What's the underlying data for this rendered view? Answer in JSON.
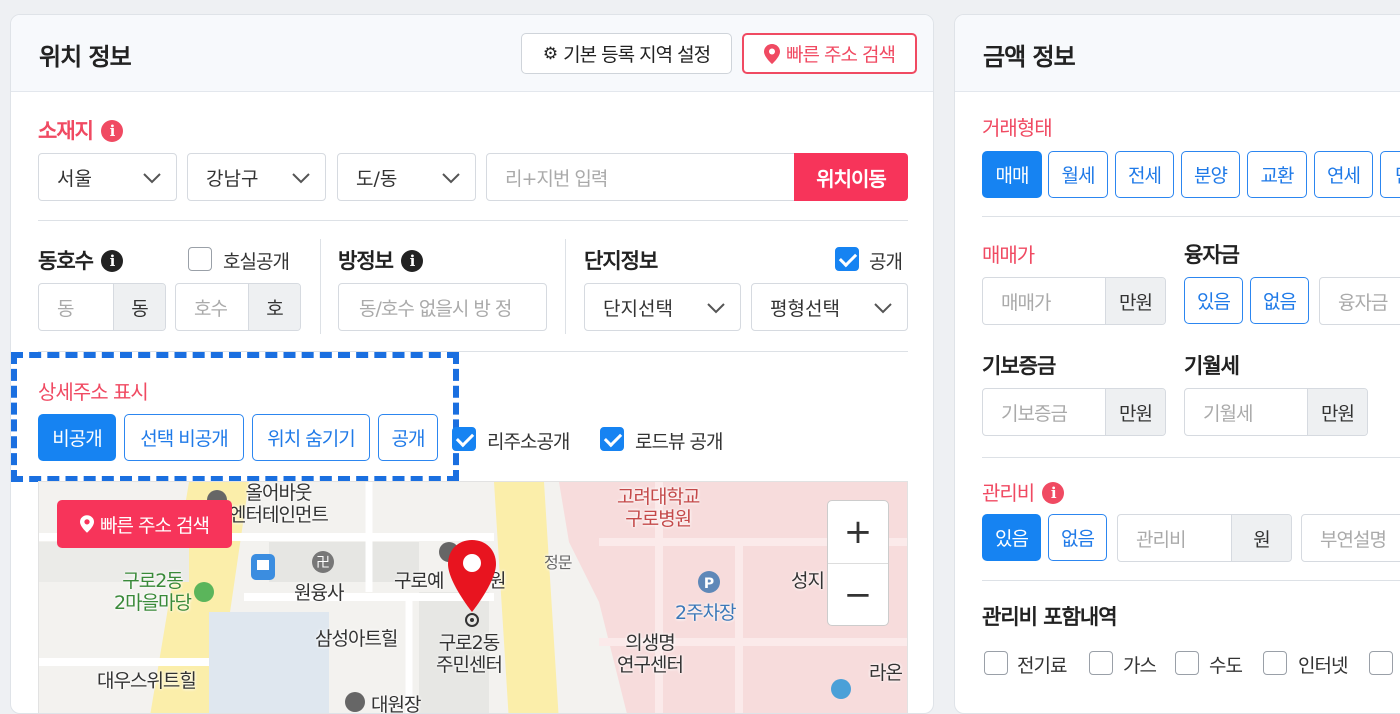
{
  "left": {
    "title": "위치 정보",
    "btn_default_region": "기본 등록 지역 설정",
    "btn_quick_search": "빠른 주소 검색",
    "location": {
      "label": "소재지",
      "city": "서울",
      "district": "강남구",
      "dong": "도/동",
      "address_placeholder": "리+지번 입력",
      "move_button": "위치이동"
    },
    "unit": {
      "label": "동호수",
      "public_label": "호실공개",
      "dong_placeholder": "동",
      "dong_unit": "동",
      "ho_placeholder": "호수",
      "ho_unit": "호"
    },
    "room": {
      "label": "방정보",
      "placeholder": "동/호수 없을시 방 정"
    },
    "complex": {
      "label": "단지정보",
      "public_label": "공개",
      "complex_select": "단지선택",
      "size_select": "평형선택"
    },
    "detail": {
      "label": "상세주소 표시",
      "options": [
        "비공개",
        "선택 비공개",
        "위치 숨기기",
        "공개"
      ],
      "ri_public": "리주소공개",
      "road_public": "로드뷰 공개"
    },
    "map": {
      "quick_search": "빠른 주소 검색",
      "zoom_in": "+",
      "zoom_out": "−",
      "labels": {
        "entertainment_a": "올어바웃",
        "entertainment_b": "엔터테인먼트",
        "univ_a": "고려대학교",
        "univ_b": "구로병원",
        "jeongmun": "정문",
        "guro_a": "구로2동",
        "guro_b": "2마을마당",
        "wonyungsa": "원융사",
        "guro_hospital_partial": "구로예",
        "guro_hospital_tail": "원",
        "parking": "2주차장",
        "seongji": "성지",
        "samsung": "삼성아트힐",
        "center_a": "구로2동",
        "center_b": "주민센터",
        "medical_a": "의생명",
        "medical_b": "연구센터",
        "daewoo": "대우스위트힐",
        "daewonjang": "대원장",
        "raon": "라온"
      }
    }
  },
  "right": {
    "title": "금액 정보",
    "deal_type": {
      "label": "거래형태",
      "options": [
        "매매",
        "월세",
        "전세",
        "분양",
        "교환",
        "연세",
        "단"
      ]
    },
    "sale_price": {
      "label": "매매가",
      "placeholder": "매매가",
      "unit": "만원"
    },
    "loan": {
      "label": "융자금",
      "yes": "있음",
      "no": "없음",
      "placeholder": "융자금"
    },
    "deposit": {
      "label": "기보증금",
      "placeholder": "기보증금",
      "unit": "만원"
    },
    "monthly": {
      "label": "기월세",
      "placeholder": "기월세",
      "unit": "만원"
    },
    "maintenance": {
      "label": "관리비",
      "yes": "있음",
      "no": "없음",
      "placeholder": "관리비",
      "unit": "원",
      "extra_placeholder": "부연설명"
    },
    "included": {
      "label": "관리비 포함내역",
      "items": [
        "전기료",
        "가스",
        "수도",
        "인터넷"
      ]
    }
  },
  "colors": {
    "accent_red": "#f7345a",
    "accent_blue": "#1683f2",
    "info_red": "#f04a62"
  }
}
